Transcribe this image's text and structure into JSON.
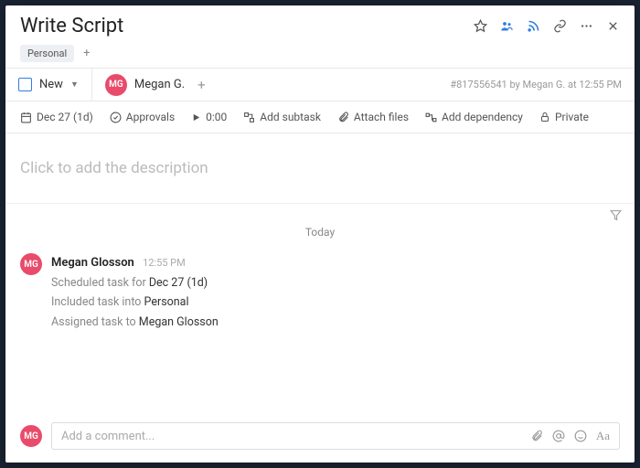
{
  "header": {
    "title": "Write Script",
    "tag": "Personal"
  },
  "status": {
    "label": "New"
  },
  "assignee": {
    "initials": "MG",
    "name": "Megan G."
  },
  "meta": "#817556541 by Megan G. at 12:55 PM",
  "toolbar": {
    "date": "Dec 27 (1d)",
    "approvals": "Approvals",
    "time": "0:00",
    "subtask": "Add subtask",
    "attach": "Attach files",
    "dependency": "Add dependency",
    "private": "Private"
  },
  "description_placeholder": "Click to add the description",
  "activity": {
    "day": "Today",
    "author_initials": "MG",
    "author": "Megan Glosson",
    "time": "12:55 PM",
    "line1_a": "Scheduled task for ",
    "line1_b": "Dec 27 (1d)",
    "line2_a": "Included task into ",
    "line2_b": "Personal",
    "line3_a": "Assigned task to ",
    "line3_b": "Megan Glosson"
  },
  "comment": {
    "initials": "MG",
    "placeholder": "Add a comment..."
  }
}
